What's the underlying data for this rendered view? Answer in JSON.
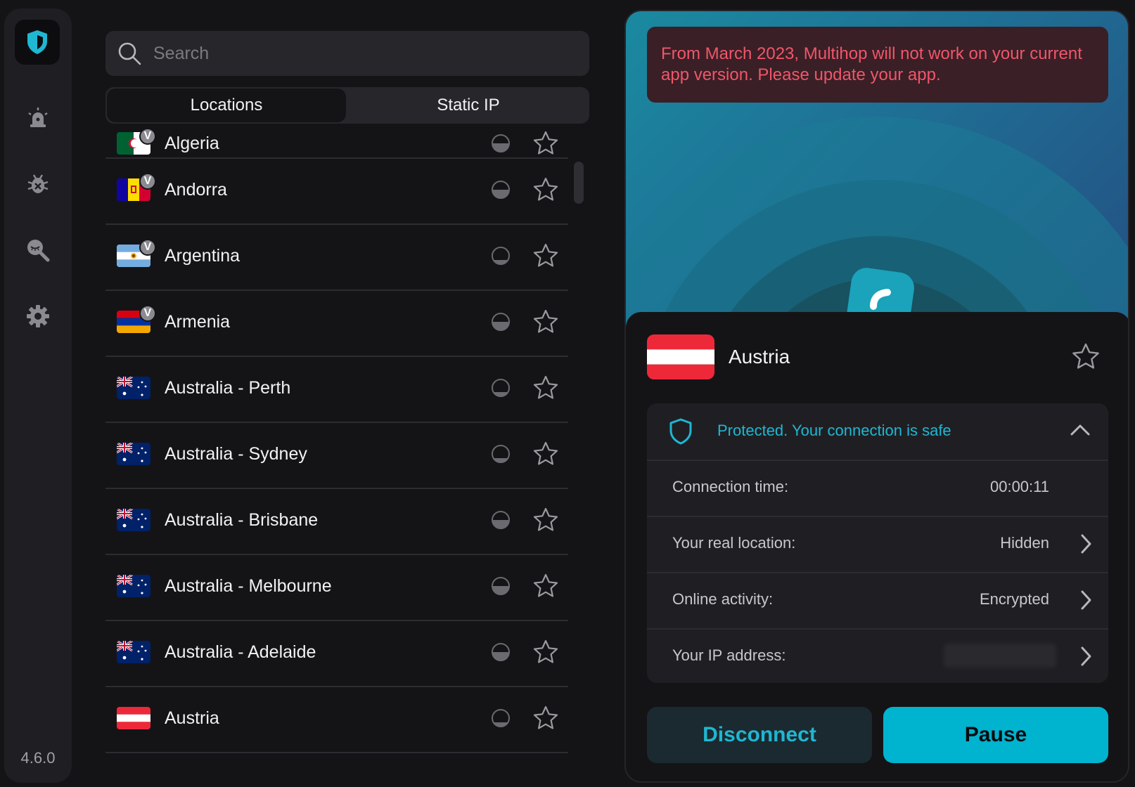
{
  "app": {
    "version": "4.6.0"
  },
  "sidebar": {
    "items": [
      {
        "name": "alert-icon"
      },
      {
        "name": "bug-icon"
      },
      {
        "name": "search-privacy-icon"
      },
      {
        "name": "settings-icon"
      }
    ]
  },
  "search": {
    "placeholder": "Search",
    "value": ""
  },
  "tabs": [
    {
      "label": "Locations",
      "active": true
    },
    {
      "label": "Static IP",
      "active": false
    }
  ],
  "locations": [
    {
      "name": "Algeria",
      "flag": "algeria",
      "badge": "V"
    },
    {
      "name": "Andorra",
      "flag": "andorra",
      "badge": "V"
    },
    {
      "name": "Argentina",
      "flag": "argentina",
      "badge": "V"
    },
    {
      "name": "Armenia",
      "flag": "armenia",
      "badge": "V"
    },
    {
      "name": "Australia - Perth",
      "flag": "australia",
      "badge": ""
    },
    {
      "name": "Australia - Sydney",
      "flag": "australia",
      "badge": ""
    },
    {
      "name": "Australia - Brisbane",
      "flag": "australia",
      "badge": ""
    },
    {
      "name": "Australia - Melbourne",
      "flag": "australia",
      "badge": ""
    },
    {
      "name": "Australia - Adelaide",
      "flag": "australia",
      "badge": ""
    },
    {
      "name": "Austria",
      "flag": "austria",
      "badge": ""
    }
  ],
  "banner": {
    "text": "From March 2023, Multihop will not work on your current app version. Please update your app."
  },
  "connection": {
    "location": "Austria",
    "status": "Protected. Your connection is safe",
    "details": [
      {
        "label": "Connection time:",
        "value": "00:00:11",
        "chevron": false
      },
      {
        "label": "Your real location:",
        "value": "Hidden",
        "chevron": true
      },
      {
        "label": "Online activity:",
        "value": "Encrypted",
        "chevron": true
      },
      {
        "label": "Your IP address:",
        "value": "",
        "chevron": true
      }
    ]
  },
  "buttons": {
    "disconnect": "Disconnect",
    "pause": "Pause"
  },
  "colors": {
    "accent": "#00b3cf",
    "error": "#f0566a",
    "background": "#141417"
  }
}
